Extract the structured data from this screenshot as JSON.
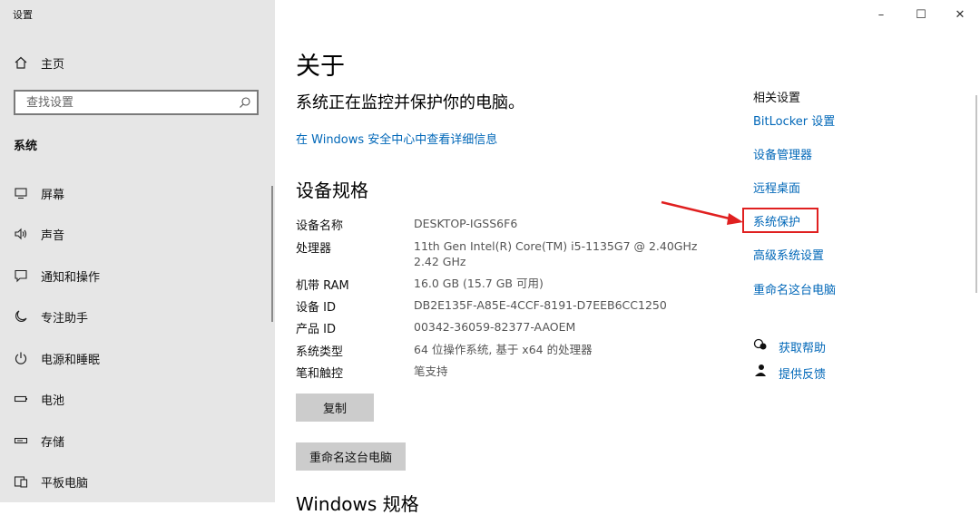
{
  "window": {
    "title": "设置",
    "controls": [
      "–",
      "☐",
      "✕"
    ]
  },
  "sidebar": {
    "home_label": "主页",
    "search": {
      "placeholder": "查找设置"
    },
    "section_title": "系统",
    "items": [
      {
        "label": "屏幕",
        "icon": "monitor-icon"
      },
      {
        "label": "声音",
        "icon": "speaker-icon"
      },
      {
        "label": "通知和操作",
        "icon": "notification-icon"
      },
      {
        "label": "专注助手",
        "icon": "moon-icon"
      },
      {
        "label": "电源和睡眠",
        "icon": "power-icon"
      },
      {
        "label": "电池",
        "icon": "battery-icon"
      },
      {
        "label": "存储",
        "icon": "storage-icon"
      },
      {
        "label": "平板电脑",
        "icon": "tablet-icon"
      }
    ]
  },
  "main": {
    "title": "关于",
    "protection_status": "系统正在监控并保护你的电脑。",
    "security_link": "在 Windows 安全中心中查看详细信息",
    "specs_title": "设备规格",
    "specs": [
      {
        "label": "设备名称",
        "value": "DESKTOP-IGSS6F6"
      },
      {
        "label": "处理器",
        "value": "11th Gen Intel(R) Core(TM) i5-1135G7 @ 2.40GHz",
        "value2": "2.42 GHz"
      },
      {
        "label": "机带 RAM",
        "value": "16.0 GB (15.7 GB 可用)"
      },
      {
        "label": "设备 ID",
        "value": "DB2E135F-A85E-4CCF-8191-D7EEB6CC1250"
      },
      {
        "label": "产品 ID",
        "value": "00342-36059-82377-AAOEM"
      },
      {
        "label": "系统类型",
        "value": "64 位操作系统, 基于 x64 的处理器"
      },
      {
        "label": "笔和触控",
        "value": "笔支持"
      }
    ],
    "copy_button": "复制",
    "rename_button": "重命名这台电脑",
    "next_section_partial": "Windows 规格"
  },
  "related": {
    "title": "相关设置",
    "links": [
      "BitLocker 设置",
      "设备管理器",
      "远程桌面",
      "系统保护",
      "高级系统设置",
      "重命名这台电脑"
    ],
    "get_help": "获取帮助",
    "feedback": "提供反馈"
  },
  "colors": {
    "link": "#0067b8",
    "highlight": "#e02020",
    "sidebar_bg": "#e6e6e6",
    "button_bg": "#cccccc"
  }
}
